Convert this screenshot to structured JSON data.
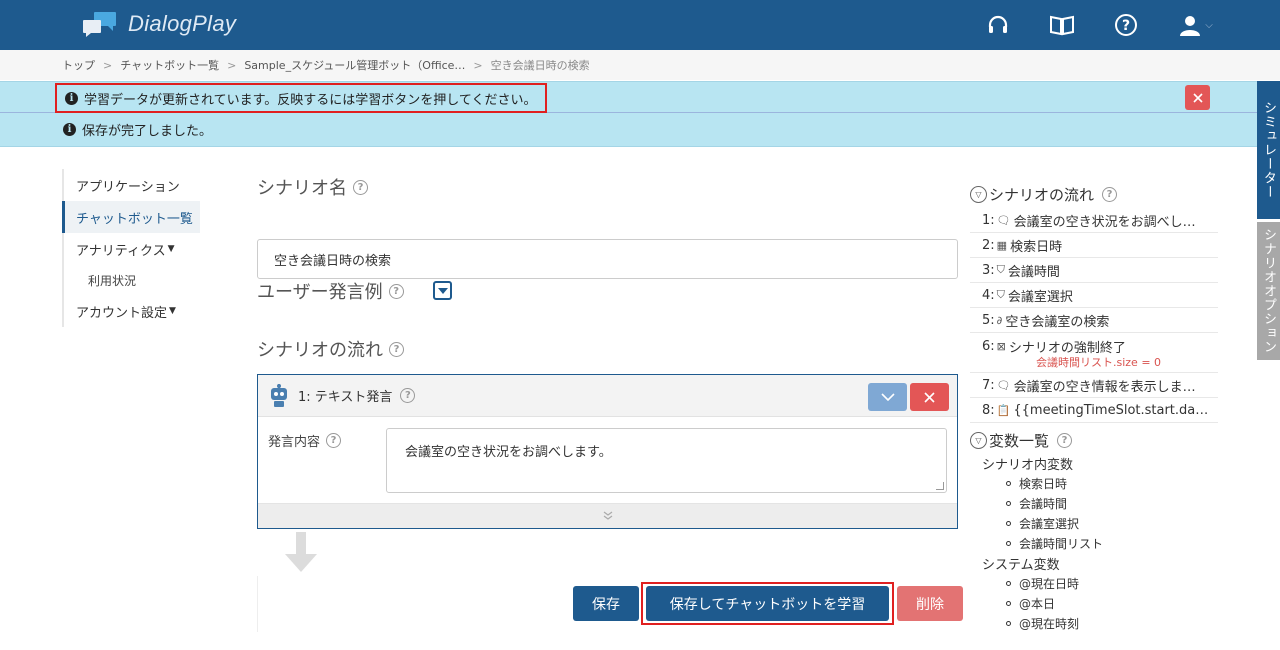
{
  "app": {
    "name": "DialogPlay",
    "brand_color": "#1e5a8e"
  },
  "header": {
    "icons": [
      "headset-icon",
      "book-icon",
      "help-icon",
      "user-icon"
    ]
  },
  "breadcrumb": {
    "items": [
      "トップ",
      "チャットボット一覧",
      "Sample_スケジュール管理ボット（Office…",
      "空き会議日時の検索"
    ]
  },
  "alerts": {
    "learning": "学習データが更新されています。反映するには学習ボタンを押してください。",
    "saved": "保存が完了しました。"
  },
  "side_tabs": {
    "simulator": "シミュレーター",
    "options": "シナリオオプション"
  },
  "nav": {
    "items": [
      "アプリケーション",
      "チャットボット一覧",
      "アナリティクス",
      "利用状況",
      "アカウント設定"
    ]
  },
  "main": {
    "scenario_name_label": "シナリオ名",
    "scenario_name_value": "空き会議日時の検索",
    "user_examples_label": "ユーザー発言例",
    "flow_label": "シナリオの流れ",
    "card": {
      "title": "1: テキスト発言",
      "field_label": "発言内容",
      "field_value": "会議室の空き状況をお調べします。"
    },
    "buttons": {
      "save": "保存",
      "save_learn": "保存してチャットボットを学習",
      "delete": "削除"
    }
  },
  "right": {
    "flow_title": "シナリオの流れ",
    "flow": [
      {
        "n": "1:",
        "icon": "speech-icon",
        "text": "会議室の空き状況をお調べし…"
      },
      {
        "n": "2:",
        "icon": "calendar-icon",
        "text": "検索日時"
      },
      {
        "n": "3:",
        "icon": "slot-icon",
        "text": "会議時間"
      },
      {
        "n": "4:",
        "icon": "slot-icon",
        "text": "会議室選択"
      },
      {
        "n": "5:",
        "icon": "link-icon",
        "text": "空き会議室の検索"
      },
      {
        "n": "6:",
        "icon": "end-icon",
        "text": "シナリオの強制終了",
        "cond": "会議時間リスト.size = 0"
      },
      {
        "n": "7:",
        "icon": "speech-icon",
        "text": "会議室の空き情報を表示しま…"
      },
      {
        "n": "8:",
        "icon": "clipboard-icon",
        "text": "{{meetingTimeSlot.start.da…"
      }
    ],
    "vars_title": "変数一覧",
    "scenario_vars_label": "シナリオ内変数",
    "scenario_vars": [
      "検索日時",
      "会議時間",
      "会議室選択",
      "会議時間リスト"
    ],
    "system_vars_label": "システム変数",
    "system_vars": [
      "@現在日時",
      "@本日",
      "@現在時刻"
    ]
  }
}
